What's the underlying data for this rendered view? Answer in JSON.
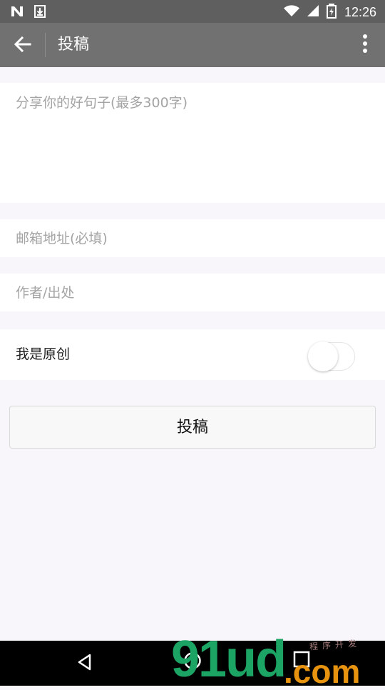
{
  "status_bar": {
    "time": "12:26",
    "icons": [
      "notification-n-icon",
      "download-icon",
      "wifi-icon",
      "signal-icon",
      "battery-charging-icon"
    ]
  },
  "header": {
    "title": "投稿",
    "back_icon": "arrow-left-icon",
    "more_icon": "more-vertical-icon"
  },
  "form": {
    "content_placeholder": "分享你的好句子(最多300字)",
    "content_value": "",
    "email_placeholder": "邮箱地址(必填)",
    "email_value": "",
    "author_placeholder": "作者/出处",
    "author_value": "",
    "original_label": "我是原创",
    "original_enabled": false,
    "submit_label": "投稿"
  },
  "navigation_bar": {
    "icons": [
      "triangle-back-icon",
      "home-circle-icon",
      "recent-apps-square-icon"
    ]
  },
  "watermark": {
    "main": "91ud",
    "domain": ".com",
    "small": "程序开发"
  },
  "colors": {
    "status_bar": "#5f5f5f",
    "app_bar": "#717171",
    "page_background": "#f8f6fb",
    "placeholder": "#a4a4a4",
    "watermark_green": "#1ca464",
    "watermark_orange": "#e89310"
  }
}
